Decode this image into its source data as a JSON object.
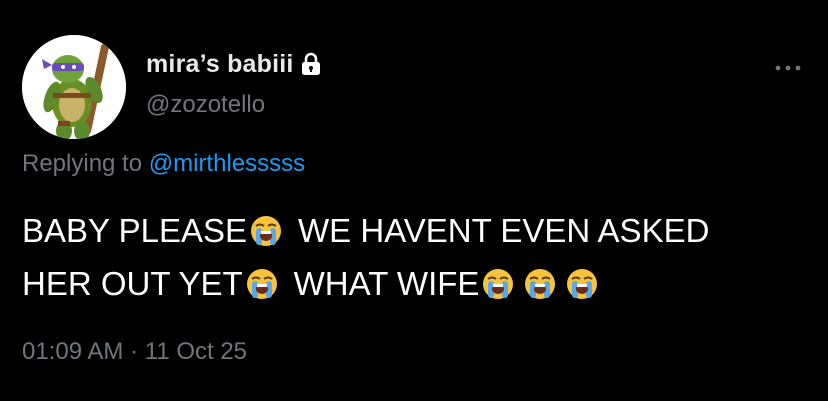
{
  "tweet": {
    "display_name": "mira’s babiii",
    "handle": "@zozotello",
    "reply_prefix": "Replying to",
    "reply_handle": "@mirthlesssss",
    "lines": [
      {
        "segments": [
          "BABY PLEASE",
          "WE HAVENT EVEN ASKED"
        ]
      },
      {
        "segments": [
          "HER OUT YET",
          "WHAT WIFE"
        ]
      }
    ],
    "emoji": "loudly-crying-face",
    "time": "01:09 AM",
    "separator": "·",
    "date": "11 Oct 25"
  },
  "icons": {
    "lock": "lock-icon",
    "more": "more-options-icon",
    "avatar": "turtle-character-avatar"
  },
  "colors": {
    "background": "#000000",
    "text": "#ffffff",
    "muted": "#71767b",
    "link": "#1d9bf0"
  }
}
